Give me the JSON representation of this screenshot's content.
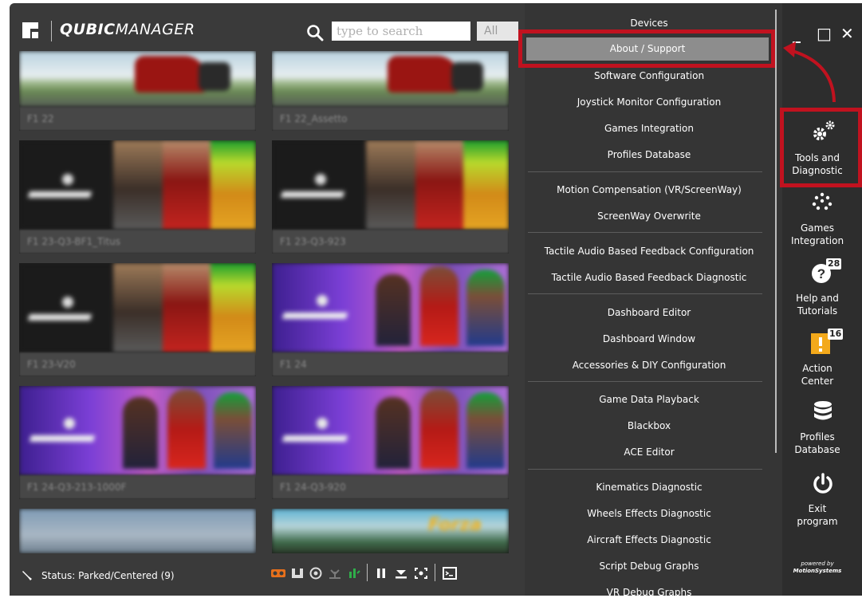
{
  "header": {
    "title_bold": "QUBIC",
    "title_rest": "MANAGER",
    "search_placeholder": "type to search",
    "filter_value": "All"
  },
  "games": [
    {
      "caption": "F1 22"
    },
    {
      "caption": "F1 22_Assetto"
    },
    {
      "caption": "F1 23-Q3-BF1_Titus"
    },
    {
      "caption": "F1 23-Q3-923"
    },
    {
      "caption": "F1 23-V20"
    },
    {
      "caption": "F1 24"
    },
    {
      "caption": "F1 24-Q3-213-1000F"
    },
    {
      "caption": "F1 24-Q3-920"
    },
    {
      "caption": ""
    },
    {
      "caption": ""
    }
  ],
  "forza_text": "Forza",
  "status": {
    "text": "Status: Parked/Centered (9)"
  },
  "menu": {
    "items": [
      "Devices",
      "About / Support",
      "Software Configuration",
      "Joystick Monitor Configuration",
      "Games Integration",
      "Profiles Database",
      "Motion Compensation (VR/ScreenWay)",
      "ScreenWay Overwrite",
      "Tactile Audio Based Feedback Configuration",
      "Tactile Audio Based Feedback Diagnostic",
      "Dashboard Editor",
      "Dashboard Window",
      "Accessories & DIY Configuration",
      "Game Data Playback",
      "Blackbox",
      "ACE Editor",
      "Kinematics Diagnostic",
      "Wheels Effects Diagnostic",
      "Aircraft Effects Diagnostic",
      "Script Debug Graphs",
      "VR Debug Graphs"
    ],
    "highlight_color": "#c1121f"
  },
  "window_controls": {
    "minimize": "_",
    "maximize": "□",
    "close": "✕"
  },
  "rail": {
    "tools_line1": "Tools and",
    "tools_line2": "Diagnostic",
    "games_line1": "Games",
    "games_line2": "Integration",
    "help_line1": "Help and",
    "help_line2": "Tutorials",
    "help_badge": "28",
    "action_line1": "Action",
    "action_line2": "Center",
    "action_badge": "16",
    "profiles_line1": "Profiles",
    "profiles_line2": "Database",
    "exit_line1": "Exit",
    "exit_line2": "program",
    "powered_line1": "powered by",
    "powered_line2": "MotionSystems"
  },
  "icons": {
    "logo": "qubic-logo-icon",
    "search": "search-icon",
    "status": "paddle-icon",
    "tools": "gears-icon",
    "games": "dots-cluster-icon",
    "help": "question-icon",
    "action": "exclamation-icon",
    "profiles": "database-icon",
    "exit": "power-icon"
  }
}
